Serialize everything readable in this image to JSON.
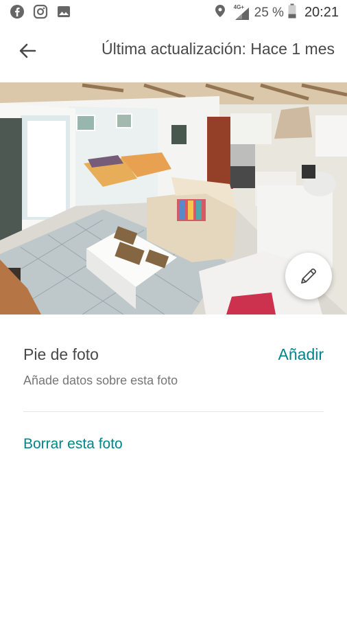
{
  "status_bar": {
    "icons_left": [
      "facebook-icon",
      "instagram-icon",
      "gallery-icon"
    ],
    "icons_right": [
      "location-icon",
      "signal-icon",
      "battery-icon"
    ],
    "network": "4G+",
    "battery": "25 %",
    "time": "20:21"
  },
  "header": {
    "back_icon": "arrow-left-icon",
    "title": "Última actualización: Hace 1 mes"
  },
  "photo": {
    "edit_icon": "pencil-icon"
  },
  "caption": {
    "label": "Pie de foto",
    "add_label": "Añadir",
    "hint": "Añade datos sobre esta foto"
  },
  "actions": {
    "delete_label": "Borrar esta foto"
  },
  "colors": {
    "accent": "#008489",
    "text": "#484848",
    "muted": "#767676"
  }
}
